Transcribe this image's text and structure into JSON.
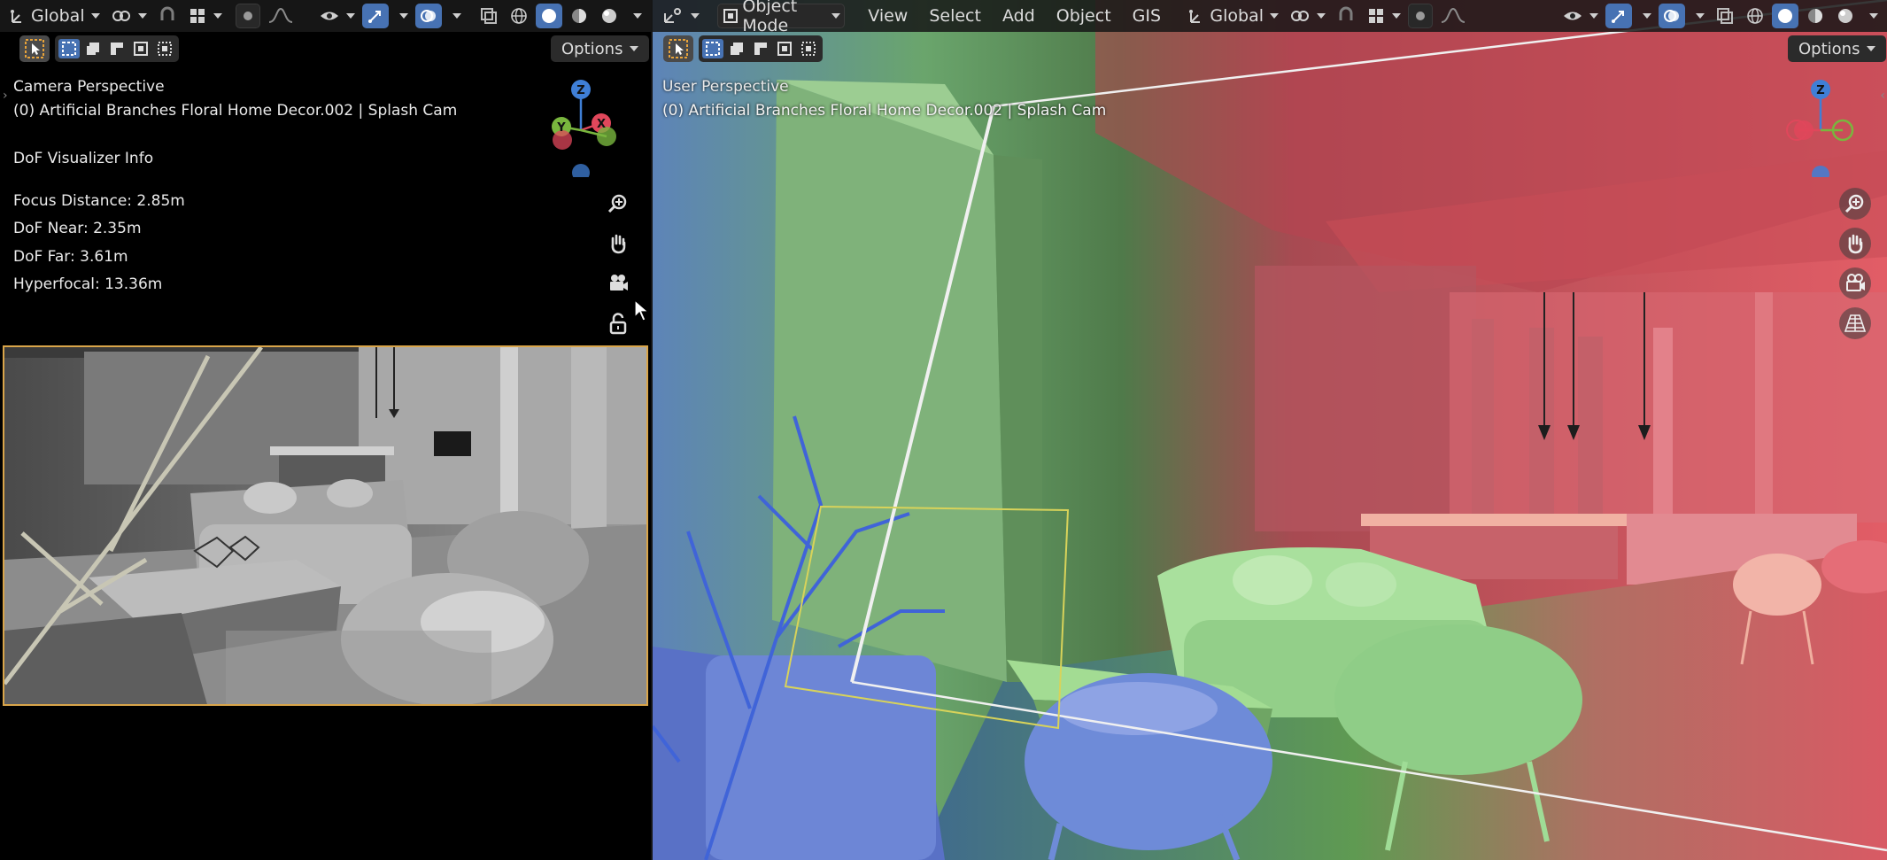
{
  "left_viewport": {
    "header": {
      "transform_orientation": "Global",
      "options_label": "Options"
    },
    "overlay": {
      "view_name": "Camera Perspective",
      "object_info": "(0) Artificial Branches Floral Home Decor.002 | Splash Cam",
      "dof_title": "DoF Visualizer Info",
      "focus_distance": "Focus Distance: 2.85m",
      "dof_near": "DoF Near: 2.35m",
      "dof_far": "DoF Far: 3.61m",
      "hyperfocal": "Hyperfocal: 13.36m"
    },
    "gizmo": {
      "x": "X",
      "y": "Y",
      "z": "Z"
    }
  },
  "right_viewport": {
    "header": {
      "mode": "Object Mode",
      "menus": [
        "View",
        "Select",
        "Add",
        "Object",
        "GIS"
      ],
      "transform_orientation": "Global",
      "options_label": "Options"
    },
    "overlay": {
      "view_name": "User Perspective",
      "object_info": "(0) Artificial Branches Floral Home Decor.002 | Splash Cam"
    },
    "gizmo": {
      "z": "Z"
    }
  },
  "colors": {
    "accent": "#4772b3",
    "camera_frame": "#d9a54a",
    "axis_x": "#e0475b",
    "axis_y": "#79b63e",
    "axis_z": "#3f7fd6",
    "dof_near": "#5d7fd8",
    "dof_focus": "#8ed08a",
    "dof_far": "#e45c68"
  },
  "icons": [
    "transform-orientation-icon",
    "snap-icon",
    "proportional-edit-icon",
    "visibility-icon",
    "gizmo-icon",
    "overlay-icon",
    "xray-icon",
    "shading-wireframe-icon",
    "shading-solid-icon",
    "shading-material-icon",
    "shading-rendered-icon",
    "zoom-icon",
    "hand-pan-icon",
    "camera-view-icon",
    "lock-icon",
    "grid-perspective-icon"
  ]
}
